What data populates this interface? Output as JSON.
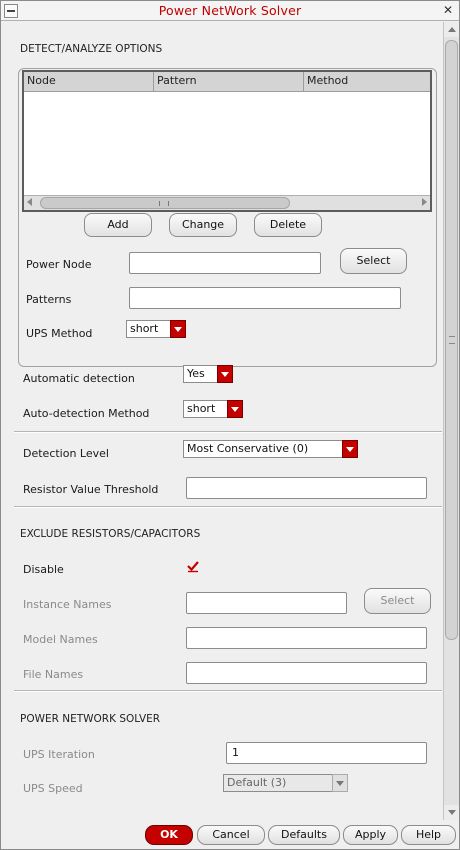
{
  "window": {
    "title": "Power NetWork Solver"
  },
  "detect": {
    "section_title": "DETECT/ANALYZE OPTIONS",
    "table_columns": [
      "Node",
      "Pattern",
      "Method"
    ],
    "rows": [],
    "buttons": {
      "add": "Add",
      "change": "Change",
      "delete": "Delete",
      "select": "Select"
    },
    "power_node": {
      "label": "Power Node",
      "value": ""
    },
    "patterns": {
      "label": "Patterns",
      "value": ""
    },
    "ups_method": {
      "label": "UPS Method",
      "value": "short"
    }
  },
  "auto": {
    "automatic_detection": {
      "label": "Automatic detection",
      "value": "Yes"
    },
    "auto_detection_method": {
      "label": "Auto-detection Method",
      "value": "short"
    }
  },
  "level": {
    "detection_level": {
      "label": "Detection Level",
      "value": "Most Conservative (0)"
    },
    "resistor_threshold": {
      "label": "Resistor Value Threshold",
      "value": ""
    }
  },
  "exclude": {
    "section_title": "EXCLUDE RESISTORS/CAPACITORS",
    "disable": {
      "label": "Disable",
      "checked": true
    },
    "instance_names": {
      "label": "Instance Names",
      "value": ""
    },
    "select": "Select",
    "model_names": {
      "label": "Model Names",
      "value": ""
    },
    "file_names": {
      "label": "File Names",
      "value": ""
    }
  },
  "solver": {
    "section_title": "POWER NETWORK SOLVER",
    "ups_iteration": {
      "label": "UPS Iteration",
      "value": "1"
    },
    "ups_speed": {
      "label": "UPS Speed",
      "value": "Default (3)"
    }
  },
  "actions": {
    "ok": "OK",
    "cancel": "Cancel",
    "defaults": "Defaults",
    "apply": "Apply",
    "help": "Help"
  },
  "colors": {
    "accent": "#c40000",
    "title": "#c00000"
  }
}
